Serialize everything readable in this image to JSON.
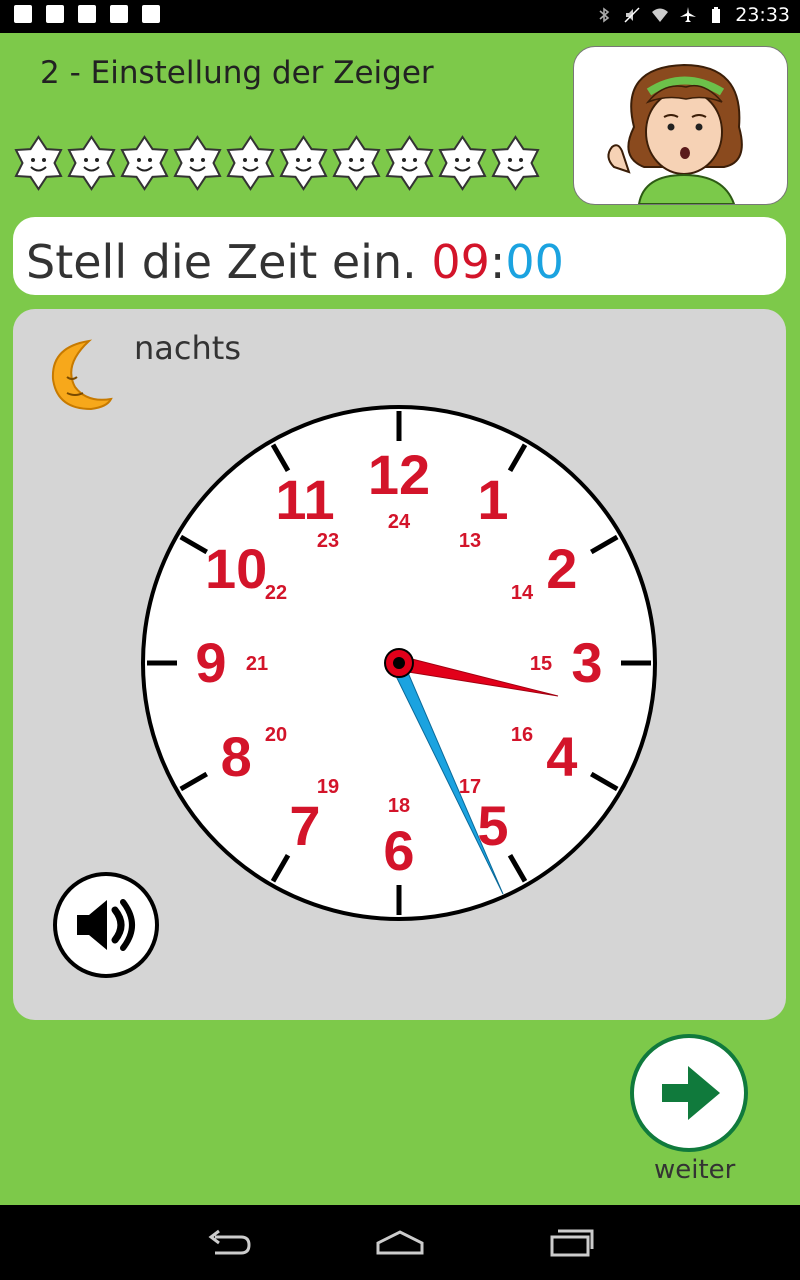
{
  "status_bar": {
    "time": "23:33",
    "left_icons": [
      "image-icon",
      "gmail-icon",
      "download-icon",
      "clipboard-check-icon",
      "shopping-bag-icon"
    ],
    "right_icons": [
      "bluetooth-icon",
      "mute-icon",
      "wifi-icon",
      "airplane-icon",
      "battery-icon"
    ]
  },
  "header": {
    "title": "2 - Einstellung der Zeiger",
    "star_count": 10
  },
  "prompt": {
    "text": "Stell die Zeit ein.",
    "hours": "09",
    "separator": ":",
    "minutes": "00"
  },
  "panel": {
    "daytime_label": "nachts"
  },
  "clock": {
    "outer_numbers": [
      "12",
      "1",
      "2",
      "3",
      "4",
      "5",
      "6",
      "7",
      "8",
      "9",
      "10",
      "11"
    ],
    "inner_numbers": [
      "24",
      "13",
      "14",
      "15",
      "16",
      "17",
      "18",
      "19",
      "20",
      "21",
      "22",
      "23"
    ],
    "hour_hand_color": "#e2001a",
    "minute_hand_color": "#1ba3e0",
    "number_color": "#d3142a"
  },
  "footer": {
    "next_label": "weiter"
  },
  "colors": {
    "background": "#7dc94a",
    "panel": "#d5d5d5",
    "next_arrow": "#107a3c"
  }
}
